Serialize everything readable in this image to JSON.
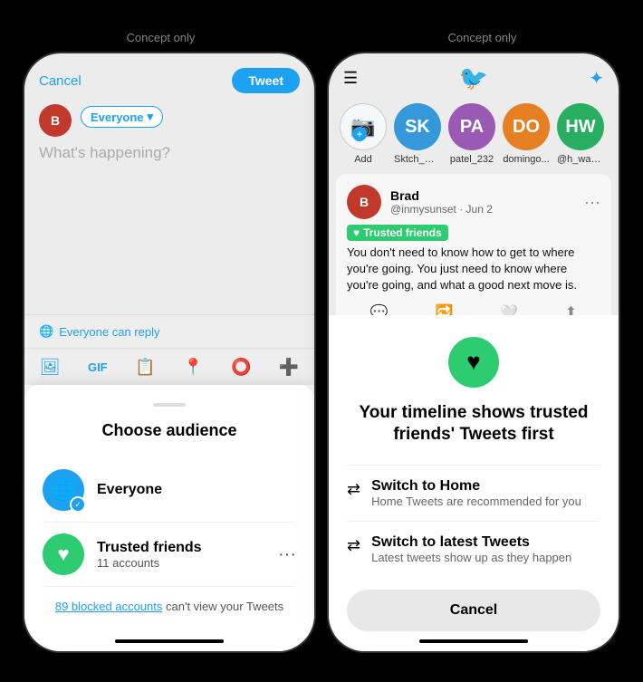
{
  "concept_label": "Concept only",
  "left_phone": {
    "cancel": "Cancel",
    "tweet": "Tweet",
    "everyone_pill": "Everyone",
    "chevron": "▾",
    "placeholder": "What's happening?",
    "can_reply": "Everyone can reply",
    "sheet": {
      "handle_hint": "drag handle",
      "title": "Choose audience",
      "options": [
        {
          "name": "Everyone",
          "icon": "🌐",
          "color": "blue",
          "checked": true
        },
        {
          "name": "Trusted friends",
          "sub": "11 accounts",
          "icon": "♥",
          "color": "green",
          "checked": false
        }
      ],
      "blocked_text": "89 blocked accounts",
      "blocked_suffix": " can't view your Tweets"
    }
  },
  "right_phone": {
    "feed": {
      "stories": [
        {
          "label": "Add",
          "is_add": true
        },
        {
          "label": "Sktch_Co...",
          "initials": "SK",
          "bg": "#3498db"
        },
        {
          "label": "patel_232",
          "initials": "PA",
          "bg": "#9b59b6"
        },
        {
          "label": "domingo...",
          "initials": "DO",
          "bg": "#e67e22"
        },
        {
          "label": "@h_wang...",
          "initials": "HW",
          "bg": "#27ae60"
        }
      ],
      "tweet": {
        "author": "Brad",
        "handle_date": "@inmysunset · Jun 2",
        "badge": "Trusted friends",
        "text": "You don't need to know how to get to where you're going. You just need to know where you're going, and what a good next move is."
      }
    },
    "sheet": {
      "icon": "♥",
      "title": "Your timeline shows trusted friends' Tweets first",
      "options": [
        {
          "title": "Switch to Home",
          "sub": "Home Tweets are recommended for you"
        },
        {
          "title": "Switch to latest Tweets",
          "sub": "Latest tweets show up as they happen"
        }
      ],
      "cancel": "Cancel"
    }
  }
}
